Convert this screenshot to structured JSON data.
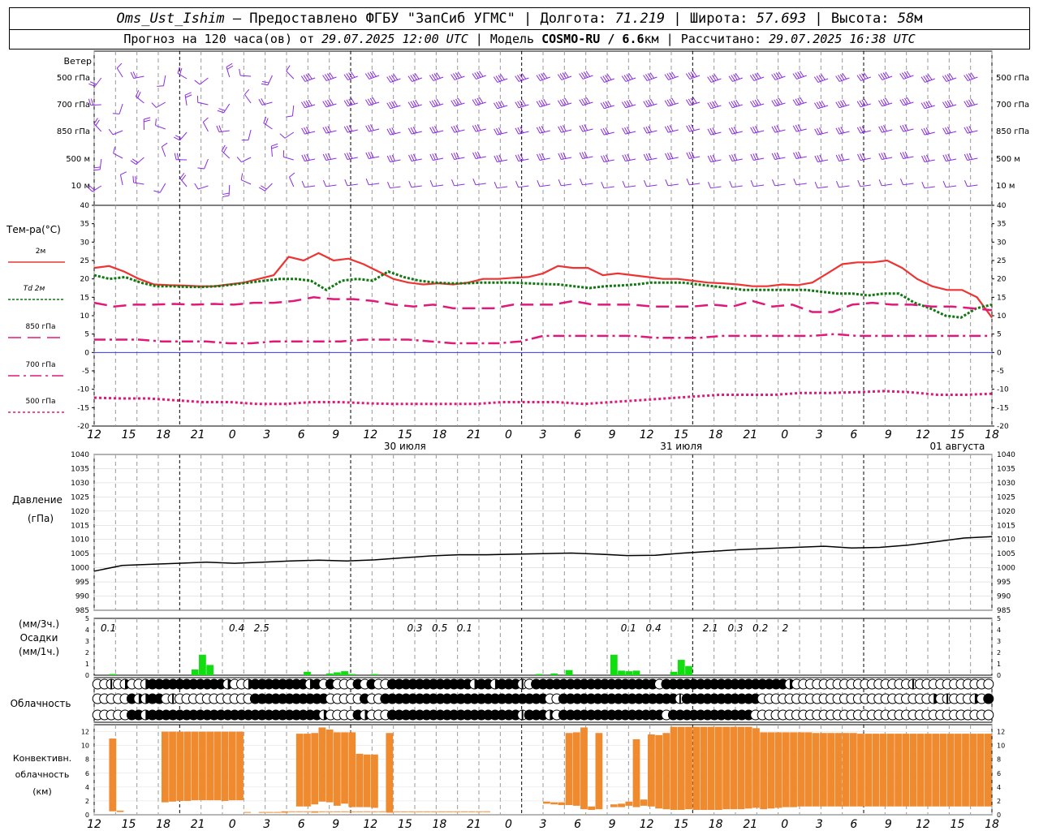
{
  "header": {
    "station": "Oms_Ust_Ishim",
    "provided": "– Предоставлено ФГБУ \"ЗапСиб УГМС\"",
    "lon_label": "Долгота:",
    "lon": "71.219",
    "lat_label": "Широта:",
    "lat": "57.693",
    "alt_label": "Высота:",
    "alt": "58",
    "alt_unit": "м",
    "forecast_label": "Прогноз на 120 часа(ов) от",
    "forecast_time": "29.07.2025 12:00 UTC",
    "model_label": "Модель",
    "model": "COSMO-RU / 6.6",
    "model_unit": "км",
    "calc_label": "Рассчитано:",
    "calc_time": "29.07.2025 16:38 UTC"
  },
  "labels": {
    "wind": "Ветер",
    "wind_levels": [
      "500 гПа",
      "700 гПа",
      "850 гПа",
      "500 м",
      "10 м"
    ],
    "temp": "Тем-ра(°C)",
    "temp_legend": [
      "2м",
      "Td 2м",
      "850 гПа",
      "700 гПа",
      "500 гПа"
    ],
    "pressure": [
      "Давление",
      "(гПа)"
    ],
    "precip": [
      "(мм/3ч.)",
      "Осадки",
      "(мм/1ч.)"
    ],
    "cloud": "Облачность",
    "conv": [
      "Конвективн.",
      "облачность",
      "(км)"
    ]
  },
  "colors": {
    "t2m": "#ee3333",
    "td2m": "#117711",
    "t850": "#e0187a",
    "t700": "#e0187a",
    "t500": "#e0187a",
    "wind": "#8a2be2",
    "pressure": "#000000",
    "precip": "#11dd11",
    "conv": "#f08a2e",
    "zero": "#3333ff"
  },
  "chart_data": {
    "type": "line",
    "x_hours": [
      12,
      15,
      18,
      21,
      0,
      3,
      6,
      9,
      12,
      15,
      18,
      21,
      0,
      3,
      6,
      9,
      12,
      15,
      18,
      21,
      0,
      3,
      6,
      9,
      12,
      15,
      18
    ],
    "day_labels": [
      {
        "hour_index": 9,
        "text": "30 июля"
      },
      {
        "hour_index": 17,
        "text": "31 июля"
      },
      {
        "hour_index": 25,
        "text": "01 августа"
      }
    ],
    "temperature": {
      "ylim": [
        -20,
        40
      ],
      "yticks": [
        -20,
        -15,
        -10,
        -5,
        0,
        5,
        10,
        15,
        20,
        25,
        30,
        35,
        40
      ],
      "series": [
        {
          "name": "2м",
          "values": [
            23,
            23.5,
            22,
            20,
            18.5,
            18.3,
            18.2,
            18,
            18,
            18.5,
            19,
            20,
            21,
            26,
            25,
            27,
            25,
            25.5,
            24,
            22,
            20,
            19,
            18.5,
            18.8,
            18.5,
            19,
            20,
            20,
            20.3,
            20.5,
            21.5,
            23.5,
            23,
            23,
            21,
            21.5,
            21,
            20.5,
            20,
            20,
            19.5,
            19,
            18.8,
            18.5,
            18,
            18,
            18.5,
            18.3,
            19,
            21.5,
            24,
            24.5,
            24.5,
            25,
            23,
            20,
            18,
            17,
            17,
            15,
            9.5
          ]
        },
        {
          "name": "Td 2м",
          "values": [
            21,
            20,
            20.5,
            19,
            18,
            18,
            17.8,
            17.8,
            18,
            18.5,
            19,
            19.5,
            20,
            20,
            19.5,
            17,
            19.5,
            20,
            19.5,
            22,
            20.5,
            19.5,
            19,
            18.8,
            18.8,
            19,
            19,
            19,
            18.8,
            18.6,
            18.5,
            18,
            17.5,
            18,
            18.2,
            18.5,
            19,
            19,
            19,
            18.5,
            18,
            17.5,
            17,
            17,
            17,
            17,
            17,
            16.5,
            16,
            16,
            15.5,
            16,
            16,
            13.5,
            12,
            10,
            9.5,
            12,
            13
          ]
        },
        {
          "name": "850 гПа",
          "values": [
            13.5,
            12.5,
            13,
            13,
            13.2,
            13,
            13.2,
            13,
            13.5,
            13.5,
            14,
            15,
            14.5,
            14.5,
            14,
            13,
            12.5,
            13,
            12,
            12,
            12,
            13,
            13,
            13,
            14,
            13,
            13,
            13,
            12.5,
            12.5,
            12.5,
            13,
            12.5,
            14,
            12.5,
            13,
            11,
            11,
            13,
            13.5,
            13,
            13,
            12.5,
            12.5,
            12,
            11.5
          ]
        },
        {
          "name": "700 гПа",
          "values": [
            3.5,
            3.5,
            3.5,
            3,
            3,
            3,
            2.5,
            2.5,
            3,
            3,
            3,
            3,
            3.5,
            3.5,
            3.5,
            3,
            2.5,
            2.5,
            2.5,
            3,
            4.5,
            4.5,
            4.5,
            4.5,
            4.5,
            4,
            4,
            4,
            4.5,
            4.5,
            4.5,
            4.5,
            4.5,
            5,
            4.5,
            4.5,
            4.5,
            4.5,
            4.5,
            4.5,
            4.5
          ]
        },
        {
          "name": "500 гПа",
          "values": [
            -12.3,
            -12.5,
            -12.5,
            -13,
            -13.5,
            -13.5,
            -14,
            -14,
            -13.5,
            -13.5,
            -13.8,
            -14,
            -14,
            -14,
            -14,
            -13.5,
            -13.5,
            -13.5,
            -14,
            -13.5,
            -13,
            -12.5,
            -12,
            -11.5,
            -11.5,
            -11.5,
            -11,
            -11,
            -10.8,
            -10.5,
            -10.8,
            -11.5,
            -11.5,
            -11.2
          ]
        }
      ]
    },
    "pressure": {
      "ylim": [
        985,
        1040
      ],
      "yticks": [
        985,
        990,
        995,
        1000,
        1005,
        1010,
        1015,
        1020,
        1025,
        1030,
        1035,
        1040
      ],
      "values": [
        998.8,
        1000.8,
        1001.2,
        1001.6,
        1002,
        1001.6,
        1002,
        1002.4,
        1002.7,
        1002.4,
        1002.8,
        1003.5,
        1004.2,
        1004.6,
        1004.6,
        1004.8,
        1005,
        1005.2,
        1004.8,
        1004.3,
        1004.4,
        1005.2,
        1005.8,
        1006.4,
        1006.8,
        1007.2,
        1007.6,
        1007,
        1007.2,
        1008,
        1009.2,
        1010.5,
        1011
      ]
    },
    "precip": {
      "ylim": [
        0,
        5
      ],
      "bars": [
        {
          "i": 2,
          "v": 0.1
        },
        {
          "i": 13,
          "v": 0.5
        },
        {
          "i": 14,
          "v": 1.8
        },
        {
          "i": 15,
          "v": 0.9
        },
        {
          "i": 28,
          "v": 0.3
        },
        {
          "i": 31,
          "v": 0.15
        },
        {
          "i": 32,
          "v": 0.25
        },
        {
          "i": 33,
          "v": 0.35
        },
        {
          "i": 34,
          "v": 0.1
        },
        {
          "i": 37,
          "v": 0.1
        },
        {
          "i": 59,
          "v": 0.1
        },
        {
          "i": 61,
          "v": 0.15
        },
        {
          "i": 63,
          "v": 0.45
        },
        {
          "i": 69,
          "v": 1.8
        },
        {
          "i": 70,
          "v": 0.4
        },
        {
          "i": 71,
          "v": 0.35
        },
        {
          "i": 72,
          "v": 0.4
        },
        {
          "i": 77,
          "v": 0.3
        },
        {
          "i": 78,
          "v": 1.35
        },
        {
          "i": 79,
          "v": 0.8
        }
      ],
      "totals": [
        {
          "hour": 2,
          "text": "0.1"
        },
        {
          "hour": 20,
          "text": "0.4"
        },
        {
          "hour": 23.5,
          "text": "2.5"
        },
        {
          "hour": 45,
          "text": "0.3"
        },
        {
          "hour": 48.5,
          "text": "0.5"
        },
        {
          "hour": 52,
          "text": "0.1"
        },
        {
          "hour": 75,
          "text": "0.1"
        },
        {
          "hour": 78.5,
          "text": "0.4"
        },
        {
          "hour": 86.5,
          "text": "2.1"
        },
        {
          "hour": 90,
          "text": "0.3"
        },
        {
          "hour": 93.5,
          "text": "0.2"
        },
        {
          "hour": 97,
          "text": "2"
        }
      ]
    },
    "convective_cloud": {
      "ylim": [
        0,
        13
      ],
      "yticks": [
        0,
        2,
        4,
        6,
        8,
        10,
        12
      ],
      "bars": [
        {
          "i": 2,
          "b": 0.5,
          "t": 11
        },
        {
          "i": 3,
          "b": 0.4,
          "t": 0.6
        },
        {
          "i": 9,
          "b": 1.8,
          "t": 12
        },
        {
          "i": 10,
          "b": 1.9,
          "t": 12
        },
        {
          "i": 11,
          "b": 2,
          "t": 12
        },
        {
          "i": 12,
          "b": 2,
          "t": 12
        },
        {
          "i": 13,
          "b": 2.1,
          "t": 12
        },
        {
          "i": 14,
          "b": 2.1,
          "t": 12
        },
        {
          "i": 15,
          "b": 2.1,
          "t": 12
        },
        {
          "i": 16,
          "b": 2.1,
          "t": 12
        },
        {
          "i": 17,
          "b": 2,
          "t": 12
        },
        {
          "i": 18,
          "b": 2.1,
          "t": 12
        },
        {
          "i": 19,
          "b": 2.1,
          "t": 12
        },
        {
          "i": 20,
          "b": 0.3,
          "t": 0.4
        },
        {
          "i": 22,
          "b": 0.3,
          "t": 0.4
        },
        {
          "i": 23,
          "b": 0.3,
          "t": 0.4
        },
        {
          "i": 24,
          "b": 0.3,
          "t": 0.4
        },
        {
          "i": 25,
          "b": 0.3,
          "t": 0.5
        },
        {
          "i": 26,
          "b": 0.4,
          "t": 0.5
        },
        {
          "i": 27,
          "b": 0.4,
          "t": 0.5
        },
        {
          "i": 28,
          "b": 0.4,
          "t": 0.5
        },
        {
          "i": 29,
          "b": 0.3,
          "t": 0.5
        },
        {
          "i": 30,
          "b": 0.4,
          "t": 0.5
        },
        {
          "i": 31,
          "b": 0.4,
          "t": 0.5
        },
        {
          "i": 32,
          "b": 0.4,
          "t": 0.5
        },
        {
          "i": 33,
          "b": 0.5,
          "t": 0.5
        },
        {
          "i": 34,
          "b": 0.5,
          "t": 0.5
        },
        {
          "i": 35,
          "b": 0.5,
          "t": 0.5
        },
        {
          "i": 36,
          "b": 0.5,
          "t": 0.5
        },
        {
          "i": 37,
          "b": 0.5,
          "t": 0.5
        },
        {
          "i": 38,
          "b": 0.5,
          "t": 0.5
        },
        {
          "i": 39,
          "b": 0.5,
          "t": 0.5
        },
        {
          "i": 40,
          "b": 0.5,
          "t": 0.5
        },
        {
          "i": 41,
          "b": 0.5,
          "t": 0.5
        },
        {
          "i": 42,
          "b": 0.5,
          "t": 0.5
        },
        {
          "i": 43,
          "b": 0.5,
          "t": 0.5
        },
        {
          "i": 44,
          "b": 0.5,
          "t": 0.5
        },
        {
          "i": 45,
          "b": 0.5,
          "t": 0.5
        },
        {
          "i": 46,
          "b": 0.5,
          "t": 0.5
        },
        {
          "i": 47,
          "b": 0.5,
          "t": 0.5
        },
        {
          "i": 48,
          "b": 0.5,
          "t": 0.5
        },
        {
          "i": 49,
          "b": 0.5,
          "t": 0.5
        },
        {
          "i": 50,
          "b": 0.5,
          "t": 0.5
        },
        {
          "i": 51,
          "b": 0.5,
          "t": 0.5
        },
        {
          "i": 52,
          "b": 0.5,
          "t": 0.5
        },
        {
          "i": 27,
          "b": 1.2,
          "t": 11.7
        },
        {
          "i": 28,
          "b": 1.2,
          "t": 11.7
        },
        {
          "i": 29,
          "b": 1.5,
          "t": 11.8
        },
        {
          "i": 30,
          "b": 1.9,
          "t": 12.6
        },
        {
          "i": 31,
          "b": 1.8,
          "t": 12.3
        },
        {
          "i": 32,
          "b": 1.3,
          "t": 11.9
        },
        {
          "i": 33,
          "b": 1.6,
          "t": 11.9
        },
        {
          "i": 34,
          "b": 1.1,
          "t": 11.9
        },
        {
          "i": 35,
          "b": 1.1,
          "t": 8.8
        },
        {
          "i": 36,
          "b": 1.1,
          "t": 8.7
        },
        {
          "i": 37,
          "b": 1.0,
          "t": 8.7
        },
        {
          "i": 39,
          "b": 0.3,
          "t": 11.8
        },
        {
          "i": 60,
          "b": 1.6,
          "t": 1.9
        },
        {
          "i": 61,
          "b": 1.5,
          "t": 1.8
        },
        {
          "i": 62,
          "b": 1.4,
          "t": 1.8
        },
        {
          "i": 63,
          "b": 1.4,
          "t": 11.8
        },
        {
          "i": 64,
          "b": 1.3,
          "t": 11.9
        },
        {
          "i": 65,
          "b": 0.8,
          "t": 12.6
        },
        {
          "i": 66,
          "b": 0.7,
          "t": 1.2
        },
        {
          "i": 67,
          "b": 0.8,
          "t": 11.8
        },
        {
          "i": 69,
          "b": 1.1,
          "t": 1.5
        },
        {
          "i": 70,
          "b": 1.1,
          "t": 1.6
        },
        {
          "i": 71,
          "b": 1.3,
          "t": 1.9
        },
        {
          "i": 72,
          "b": 1.1,
          "t": 10.9
        },
        {
          "i": 73,
          "b": 1.3,
          "t": 2.2
        },
        {
          "i": 74,
          "b": 1.2,
          "t": 11.6
        },
        {
          "i": 75,
          "b": 0.9,
          "t": 11.5
        },
        {
          "i": 76,
          "b": 0.8,
          "t": 11.8
        },
        {
          "i": 77,
          "b": 0.7,
          "t": 12.7
        },
        {
          "i": 78,
          "b": 0.7,
          "t": 12.7
        },
        {
          "i": 79,
          "b": 0.8,
          "t": 12.7
        },
        {
          "i": 80,
          "b": 0.7,
          "t": 12.7
        },
        {
          "i": 81,
          "b": 0.7,
          "t": 12.7
        },
        {
          "i": 82,
          "b": 0.7,
          "t": 12.7
        },
        {
          "i": 83,
          "b": 0.7,
          "t": 12.7
        },
        {
          "i": 84,
          "b": 0.8,
          "t": 12.7
        },
        {
          "i": 85,
          "b": 0.8,
          "t": 12.7
        },
        {
          "i": 86,
          "b": 0.8,
          "t": 12.7
        },
        {
          "i": 87,
          "b": 0.9,
          "t": 12.7
        },
        {
          "i": 88,
          "b": 1.0,
          "t": 12.5
        },
        {
          "i": 89,
          "b": 0.8,
          "t": 11.9
        },
        {
          "i": 90,
          "b": 0.9,
          "t": 11.9
        },
        {
          "i": 91,
          "b": 1.0,
          "t": 11.9
        },
        {
          "i": 92,
          "b": 1.1,
          "t": 11.9
        },
        {
          "i": 93,
          "b": 1.1,
          "t": 11.9
        },
        {
          "i": 94,
          "b": 1.2,
          "t": 11.9
        },
        {
          "i": 95,
          "b": 1.2,
          "t": 11.9
        },
        {
          "i": 96,
          "b": 1.2,
          "t": 11.8
        },
        {
          "i": 97,
          "b": 1.2,
          "t": 11.8
        },
        {
          "i": 98,
          "b": 1.2,
          "t": 11.8
        },
        {
          "i": 99,
          "b": 1.2,
          "t": 11.8
        },
        {
          "i": 100,
          "b": 1.2,
          "t": 11.8
        },
        {
          "i": 101,
          "b": 1.2,
          "t": 11.8
        },
        {
          "i": 102,
          "b": 1.2,
          "t": 11.7
        },
        {
          "i": 103,
          "b": 1.2,
          "t": 11.7
        },
        {
          "i": 104,
          "b": 1.2,
          "t": 11.7
        },
        {
          "i": 105,
          "b": 1.2,
          "t": 11.7
        },
        {
          "i": 106,
          "b": 1.2,
          "t": 11.7
        },
        {
          "i": 107,
          "b": 1.2,
          "t": 11.7
        },
        {
          "i": 108,
          "b": 1.2,
          "t": 11.7
        },
        {
          "i": 109,
          "b": 1.2,
          "t": 11.7
        },
        {
          "i": 110,
          "b": 1.2,
          "t": 11.7
        },
        {
          "i": 111,
          "b": 1.2,
          "t": 11.7
        },
        {
          "i": 112,
          "b": 1.2,
          "t": 11.7
        },
        {
          "i": 113,
          "b": 1.2,
          "t": 11.7
        },
        {
          "i": 114,
          "b": 1.2,
          "t": 11.7
        },
        {
          "i": 115,
          "b": 1.2,
          "t": 11.7
        },
        {
          "i": 116,
          "b": 1.2,
          "t": 11.7
        },
        {
          "i": 117,
          "b": 1.2,
          "t": 11.7
        },
        {
          "i": 118,
          "b": 1.2,
          "t": 11.7
        },
        {
          "i": 119,
          "b": 1.2,
          "t": 11.7
        }
      ]
    },
    "cloud_rows": [
      "00102002333333333332002333333332303000303003333333333332332333103333333333333333330333333333333333333200000000000000000100000000000",
      "00000322330100000000000333333333330000030033333333333333333333333300333333333333333331333333333330000000000000000000000000201000203",
      "00000332333333333333333333333333320000320003333333333333333333133320333333333333333033333333333300000000000000000000000000000000000"
    ]
  }
}
